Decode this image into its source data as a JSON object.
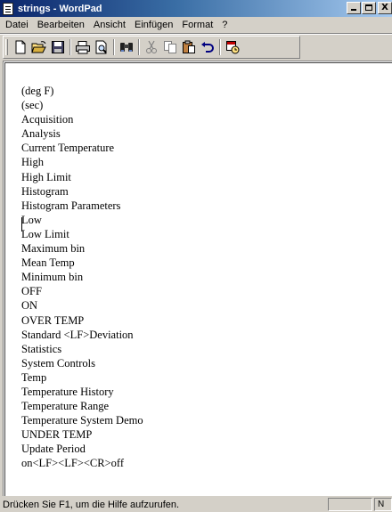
{
  "window": {
    "title": "strings - WordPad",
    "close_glyph": "X"
  },
  "menu": [
    "Datei",
    "Bearbeiten",
    "Ansicht",
    "Einfügen",
    "Format",
    "?"
  ],
  "toolbar": {
    "buttons": [
      "new",
      "open",
      "save",
      "print",
      "print-preview",
      "find",
      "cut",
      "copy",
      "paste",
      "undo",
      "insert-date-time"
    ]
  },
  "document": {
    "lines": [
      "(deg F)",
      "(sec)",
      "Acquisition",
      "Analysis",
      "Current Temperature",
      "High",
      "High Limit",
      "Histogram",
      "Histogram Parameters",
      "Low",
      "Low Limit",
      "Maximum bin",
      "Mean Temp",
      "Minimum bin",
      "OFF",
      "ON",
      "OVER TEMP",
      "Standard <LF>Deviation",
      "Statistics",
      "System Controls",
      "Temp",
      "Temperature History",
      "Temperature Range",
      "Temperature System Demo",
      "UNDER TEMP",
      "Update Period",
      "on<LF><LF><CR>off"
    ]
  },
  "status": {
    "text": "Drücken Sie F1, um die Hilfe aufzurufen.",
    "pane_text": "N"
  },
  "colors": {
    "titlebar_start": "#0a246a",
    "titlebar_end": "#a6caf0",
    "face": "#d4d0c8",
    "document_bg": "#ffffff"
  }
}
